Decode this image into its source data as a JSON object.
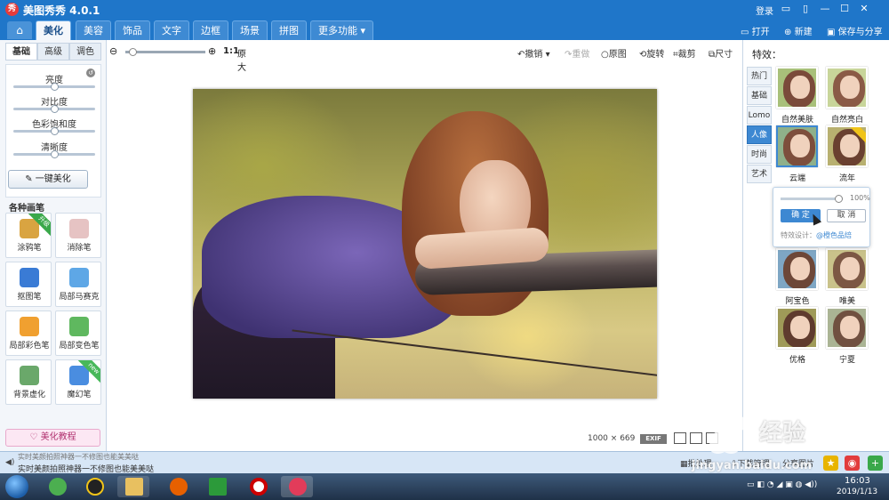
{
  "window": {
    "logo_char": "秀",
    "title": "美图秀秀 4.0.1",
    "login": "登录",
    "controls": [
      "▭",
      "▯",
      "—",
      "☐",
      "✕"
    ]
  },
  "menu": {
    "home_icon": "home-icon",
    "tabs": [
      "美化",
      "美容",
      "饰品",
      "文字",
      "边框",
      "场景",
      "拼图",
      "更多功能 ▾"
    ],
    "active_tab": "美化",
    "actions": {
      "open": "打开",
      "new": "新建",
      "save_share": "保存与分享"
    }
  },
  "left_panel": {
    "subtabs": [
      "基础",
      "高级",
      "调色"
    ],
    "active_subtab": "基础",
    "sliders": [
      {
        "label": "亮度",
        "level": 0.5
      },
      {
        "label": "对比度",
        "level": 0.5
      },
      {
        "label": "色彩饱和度",
        "level": 0.5
      },
      {
        "label": "清晰度",
        "level": 0.5
      }
    ],
    "reset_icon": "reset-icon",
    "one_key_button": "一键美化",
    "pens_title": "各种画笔",
    "pens": [
      {
        "label": "涂鸦笔",
        "badge": "升级",
        "color": "#d9a441"
      },
      {
        "label": "消除笔",
        "badge": "",
        "color": "#e6c3c3"
      },
      {
        "label": "抠图笔",
        "badge": "",
        "color": "#3a7bd5"
      },
      {
        "label": "局部马赛克",
        "badge": "",
        "color": "#5ea7e6"
      },
      {
        "label": "局部彩色笔",
        "badge": "",
        "color": "#f0a030"
      },
      {
        "label": "局部变色笔",
        "badge": "",
        "color": "#5fb85f"
      },
      {
        "label": "背景虚化",
        "badge": "",
        "color": "#6aa86a"
      },
      {
        "label": "魔幻笔",
        "badge": "new",
        "color": "#4a8de0"
      }
    ],
    "tutorial_button": "美化教程"
  },
  "workspace": {
    "zoom_ratio_label": "1:1",
    "zoom_original": "原大",
    "zoom_level": 0.05,
    "tools": {
      "undo": "撤销",
      "redo": "重做",
      "original": "原图",
      "rotate": "旋转",
      "crop": "裁剪",
      "resize": "尺寸"
    },
    "image_width": "1000",
    "image_sep": "×",
    "image_height": "669",
    "exif": "EXIF"
  },
  "right_panel": {
    "title": "特效：",
    "categories": [
      "热门",
      "基础",
      "Lomo",
      "人像",
      "时尚",
      "艺术"
    ],
    "active_category": "人像",
    "effects": [
      {
        "label": "自然美肤",
        "tone": "#7a4a3a",
        "bg": "#a8c07a"
      },
      {
        "label": "自然亮白",
        "tone": "#8a5a46",
        "bg": "#c8d59a"
      },
      {
        "label": "云端",
        "tone": "#7d4e3c",
        "bg": "#8fb08a",
        "selected": true
      },
      {
        "label": "流年",
        "tone": "#6a4030",
        "bg": "#b8b070"
      },
      {
        "label": "阿宝色",
        "tone": "#6d4738",
        "bg": "#7ea6c4"
      },
      {
        "label": "唯美",
        "tone": "#7c5744",
        "bg": "#c9c28a"
      },
      {
        "label": "优格",
        "tone": "#5f3b2e",
        "bg": "#9f9a58"
      },
      {
        "label": "宁夏",
        "tone": "#705040",
        "bg": "#aab494"
      }
    ],
    "popover": {
      "percent": "100%",
      "level": 1.0,
      "ok": "确 定",
      "cancel": "取 消",
      "design_label": "特效设计：",
      "designer": "@橙色品焙"
    }
  },
  "status": {
    "line1": "实时美颜拍照神器一不修图也能美美哒",
    "line2": "实时美颜拍照神器一不修图也能美美哒",
    "batch": "批处理",
    "download": "下载管理",
    "share": "分享图片"
  },
  "taskbar": {
    "time": "16:03",
    "date": "2019/1/13",
    "tray": "▭ ◧ ◔ ◢ ▣ ◍ ◀))"
  },
  "watermark": {
    "text": "经验",
    "url": "jingyan.baidu.com"
  }
}
